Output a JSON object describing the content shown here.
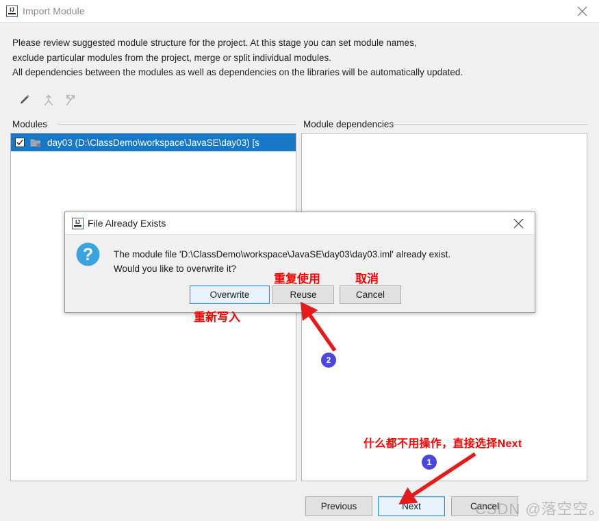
{
  "window": {
    "title": "Import Module",
    "icon": "intellij-idea-icon",
    "close_icon": "close-icon"
  },
  "description": {
    "line1": "Please review suggested module structure for the project. At this stage you can set module names,",
    "line2": "exclude particular modules from the project, merge or split individual modules.",
    "line3": "All dependencies between the modules as well as dependencies on the libraries will be automatically updated."
  },
  "toolbar": {
    "edit_icon": "pencil-edit-icon",
    "merge_icon": "merge-modules-icon",
    "split_icon": "split-modules-icon"
  },
  "panels": {
    "modules_label": "Modules",
    "dependencies_label": "Module dependencies",
    "module_row": {
      "checked": true,
      "icon": "module-folder-icon",
      "label": "day03 (D:\\ClassDemo\\workspace\\JavaSE\\day03) [s"
    },
    "dependencies_items": []
  },
  "wizard_buttons": {
    "previous": "Previous",
    "next": "Next",
    "cancel": "Cancel",
    "focused": "Next"
  },
  "dialog": {
    "title": "File Already Exists",
    "icon": "intellij-idea-icon",
    "close_icon": "close-icon",
    "message_icon": "question-mark-icon",
    "message_line1": "The module file 'D:\\ClassDemo\\workspace\\JavaSE\\day03\\day03.iml' already exist.",
    "message_line2": "Would you like to overwrite it?",
    "buttons": {
      "overwrite": "Overwrite",
      "reuse": "Reuse",
      "cancel": "Cancel",
      "focused": "Overwrite"
    }
  },
  "annotations": {
    "reuse_note": "重复使用",
    "cancel_note": "取消",
    "overwrite_note": "重新写入",
    "next_note": "什么都不用操作，直接选择Next",
    "badge_1": "1",
    "badge_2": "2",
    "color": "#ff0000",
    "badge_color": "#4b46e0"
  },
  "watermark": {
    "text": "CSDN @落空空。"
  },
  "colors": {
    "selection_blue": "#1878c8",
    "focus_blue": "#2196e0",
    "window_bg": "#f0f0f0",
    "panel_bg": "#ffffff"
  }
}
